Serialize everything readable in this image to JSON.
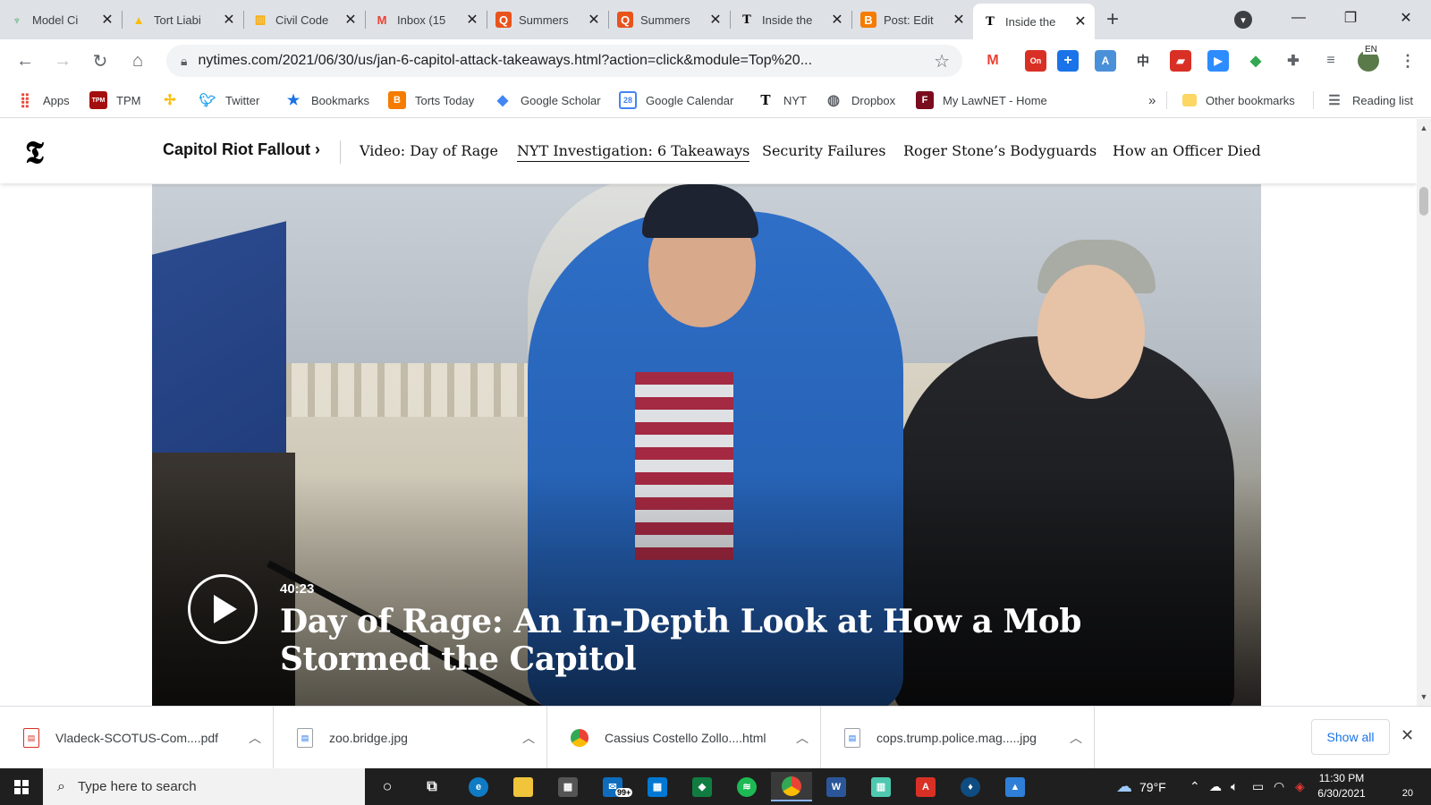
{
  "tabs": [
    {
      "label": "Model Ci",
      "icon": "plant-icon",
      "color": "#34a853"
    },
    {
      "label": "Tort Liabi",
      "icon": "google-drive-icon",
      "color": "#fbbc04"
    },
    {
      "label": "Civil Code",
      "icon": "slides-icon",
      "color": "#f9ab00"
    },
    {
      "label": "Inbox (15",
      "icon": "gmail-icon",
      "color": "#ea4335"
    },
    {
      "label": "Summers",
      "icon": "q-icon",
      "color": "#e8531c"
    },
    {
      "label": "Summers",
      "icon": "q-icon",
      "color": "#e8531c"
    },
    {
      "label": "Inside the",
      "icon": "nyt-icon",
      "color": "#000000"
    },
    {
      "label": "Post: Edit",
      "icon": "blogger-icon",
      "color": "#f57c00"
    },
    {
      "label": "Inside the",
      "icon": "nyt-icon",
      "color": "#000000",
      "active": true
    }
  ],
  "address": {
    "url": "nytimes.com/2021/06/30/us/jan-6-capitol-attack-takeaways.html?action=click&module=Top%20..."
  },
  "toolbar_extras": {
    "ext_badge": "On",
    "lang": "EN"
  },
  "bookmarks": {
    "items": [
      {
        "label": "Apps",
        "icon": "apps-grid-icon"
      },
      {
        "label": "TPM",
        "icon": "tpm-icon"
      },
      {
        "label": "",
        "icon": "pinwheel-icon"
      },
      {
        "label": "Twitter",
        "icon": "twitter-icon"
      },
      {
        "label": "Bookmarks",
        "icon": "star-icon"
      },
      {
        "label": "Torts Today",
        "icon": "blogger-icon"
      },
      {
        "label": "Google Scholar",
        "icon": "scholar-icon"
      },
      {
        "label": "Google Calendar",
        "icon": "calendar-icon"
      },
      {
        "label": "NYT",
        "icon": "nyt-icon"
      },
      {
        "label": "Dropbox",
        "icon": "globe-icon"
      },
      {
        "label": "My LawNET - Home",
        "icon": "lawnet-icon"
      }
    ],
    "more": "»",
    "other": "Other bookmarks",
    "reading_list": "Reading list"
  },
  "nyt": {
    "section": "Capitol Riot Fallout",
    "section_chevron": "›",
    "links": [
      {
        "label": "Video: Day of Rage"
      },
      {
        "label": "NYT Investigation: 6 Takeaways",
        "active": true
      },
      {
        "label": "Security Failures"
      },
      {
        "label": "Roger Stone’s Bodyguards"
      },
      {
        "label": "How an Officer Died"
      }
    ]
  },
  "video": {
    "duration": "40:23",
    "title": "Day of Rage: An In-Depth Look at How a Mob Stormed the Capitol"
  },
  "downloads": [
    {
      "name": "Vladeck-SCOTUS-Com....pdf",
      "icon": "pdf-file-icon"
    },
    {
      "name": "zoo.bridge.jpg",
      "icon": "image-file-icon"
    },
    {
      "name": "Cassius Costello Zollo....html",
      "icon": "chrome-icon"
    },
    {
      "name": "cops.trump.police.mag.....jpg",
      "icon": "image-file-icon"
    }
  ],
  "download_shelf": {
    "show_all": "Show all"
  },
  "taskbar": {
    "search_placeholder": "Type here to search",
    "mail_badge": "99+",
    "weather": "79°F",
    "time": "11:30 PM",
    "date": "6/30/2021",
    "notifications": "20"
  }
}
